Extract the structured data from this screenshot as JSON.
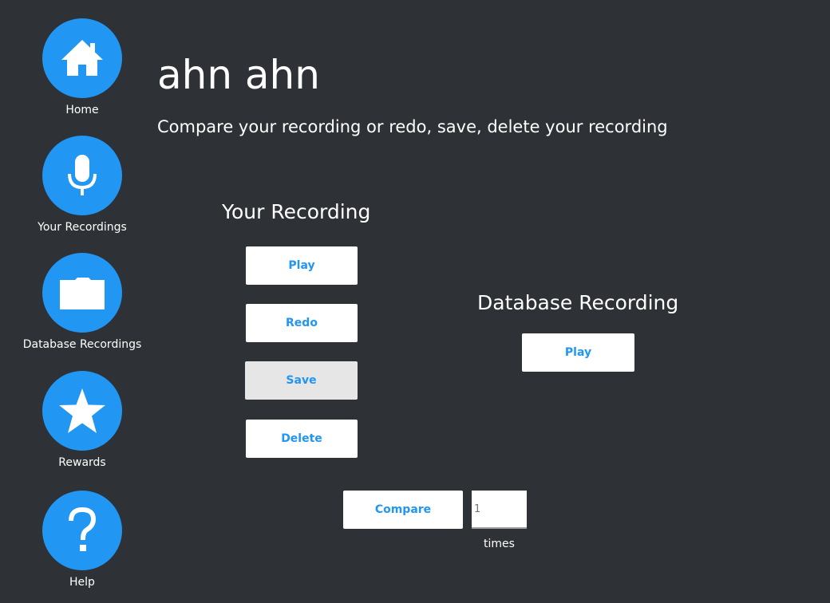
{
  "sidebar": {
    "items": [
      {
        "label": "Home",
        "icon": "home-icon"
      },
      {
        "label": "Your Recordings",
        "icon": "microphone-icon"
      },
      {
        "label": "Database Recordings",
        "icon": "folder-icon"
      },
      {
        "label": "Rewards",
        "icon": "star-icon"
      },
      {
        "label": "Help",
        "icon": "help-icon"
      }
    ]
  },
  "header": {
    "title": "ahn ahn",
    "subtitle": "Compare your recording or redo, save, delete your recording"
  },
  "your_recording": {
    "heading": "Your Recording",
    "play_label": "Play",
    "redo_label": "Redo",
    "save_label": "Save",
    "delete_label": "Delete"
  },
  "database_recording": {
    "heading": "Database Recording",
    "play_label": "Play"
  },
  "compare": {
    "button_label": "Compare",
    "times_placeholder": "1",
    "times_label": "times"
  },
  "colors": {
    "background": "#2e3135",
    "accent": "#2196f3",
    "button_bg": "#ffffff",
    "disabled_button_bg": "#e6e6e6"
  }
}
